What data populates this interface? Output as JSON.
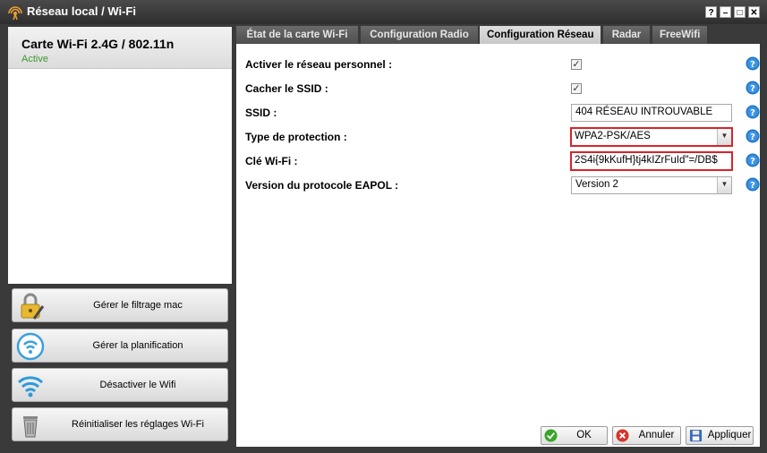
{
  "window": {
    "title": "Réseau local / Wi-Fi",
    "buttons": [
      "?",
      "–",
      "□",
      "✕"
    ]
  },
  "device": {
    "name": "Carte Wi-Fi 2.4G / 802.11n",
    "status": "Active"
  },
  "actions": [
    {
      "label": "Gérer le filtrage mac",
      "icon": "padlock-icon"
    },
    {
      "label": "Gérer la planification",
      "icon": "wifi-schedule-icon"
    },
    {
      "label": "Désactiver le Wifi",
      "icon": "wifi-icon"
    },
    {
      "label": "Réinitialiser les réglages Wi-Fi",
      "icon": "trash-can-icon"
    }
  ],
  "tabs": [
    {
      "label": "État de la carte Wi-Fi",
      "active": false
    },
    {
      "label": "Configuration Radio",
      "active": false
    },
    {
      "label": "Configuration Réseau",
      "active": true
    },
    {
      "label": "Radar",
      "active": false
    },
    {
      "label": "FreeWifi",
      "active": false
    }
  ],
  "form": {
    "enable_personal": {
      "label": "Activer le réseau personnel :",
      "checked": true
    },
    "hide_ssid": {
      "label": "Cacher le SSID :",
      "checked": true
    },
    "ssid": {
      "label": "SSID :",
      "value": "404 RÉSEAU INTROUVABLE"
    },
    "protection": {
      "label": "Type de protection :",
      "value": "WPA2-PSK/AES"
    },
    "wifi_key": {
      "label": "Clé Wi-Fi :",
      "value": "2S4i{9kKufH}tj4kIZrFuId\"=/DB$"
    },
    "eapol": {
      "label": "Version du protocole EAPOL :",
      "value": "Version 2"
    }
  },
  "footer": {
    "ok": "OK",
    "cancel": "Annuler",
    "apply": "Appliquer"
  },
  "colors": {
    "highlight": "#d8232a",
    "help": "#1a73c8",
    "active_status": "#3a9a2a"
  }
}
